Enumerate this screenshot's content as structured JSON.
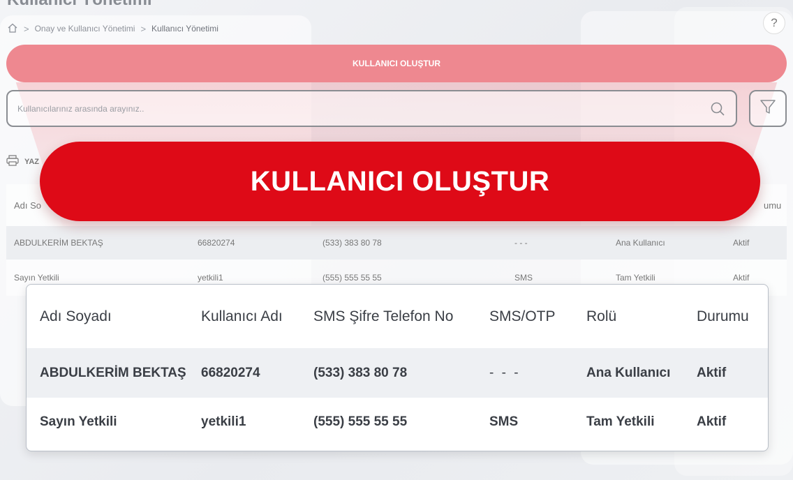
{
  "page": {
    "title": "Kullanıcı Yönetimi",
    "help": "?"
  },
  "breadcrumb": {
    "home_icon": "home-icon",
    "separator": ">",
    "items": [
      "Onay ve Kullanıcı Yönetimi",
      "Kullanıcı Yönetimi"
    ]
  },
  "create_button": {
    "label": "KULLANICI OLUŞTUR"
  },
  "search": {
    "placeholder": "Kullanıcılarınız arasında arayınız.."
  },
  "print": {
    "icon": "printer-icon",
    "label": "YAZ"
  },
  "hero_button": {
    "label": "KULLANICI OLUŞTUR"
  },
  "table": {
    "columns": [
      "Adı Soyadı",
      "Kullanıcı Adı",
      "SMS Şifre Telefon No",
      "SMS/OTP",
      "Rolü",
      "Durumu"
    ],
    "background_header_visible": [
      "Adı So",
      "umu"
    ],
    "rows": [
      [
        "ABDULKERİM BEKTAŞ",
        "66820274",
        "(533) 383 80 78",
        "- - -",
        "Ana Kullanıcı",
        "Aktif"
      ],
      [
        "Sayın Yetkili",
        "yetkili1",
        "(555) 555 55 55",
        "SMS",
        "Tam Yetkili",
        "Aktif"
      ]
    ]
  },
  "colors": {
    "primary_red": "#de0a17",
    "faded_red": "#ee8890"
  }
}
